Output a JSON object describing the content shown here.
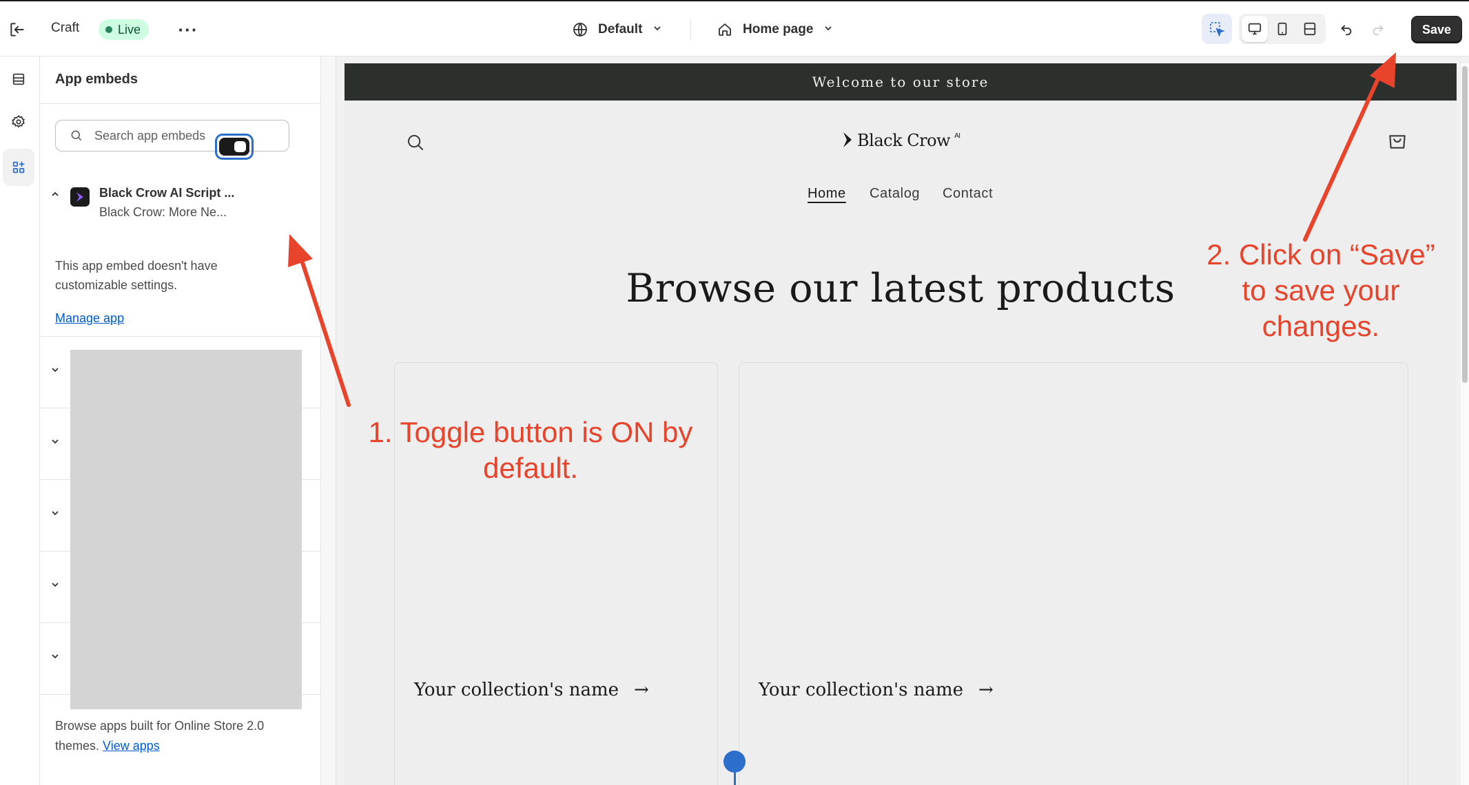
{
  "topbar": {
    "app_name": "Craft",
    "status_badge": "Live",
    "theme_label": "Default",
    "page_label": "Home page",
    "save_label": "Save"
  },
  "panel": {
    "title": "App embeds",
    "search_placeholder": "Search app embeds",
    "embed": {
      "title": "Black Crow AI Script ...",
      "subtitle": "Black Crow: More Ne...",
      "toggle_on": true,
      "description": "This app embed doesn't have customizable settings.",
      "manage_link": "Manage app"
    },
    "browse_note": "Browse apps built for Online Store 2.0 themes.",
    "browse_link": "View apps"
  },
  "preview": {
    "announcement": "Welcome to our store",
    "logo_text": "Black Crow",
    "logo_super": "AI",
    "nav": [
      "Home",
      "Catalog",
      "Contact"
    ],
    "heading": "Browse our latest products",
    "collections": [
      "Your collection's name",
      "Your collection's name"
    ],
    "arrow_glyph": "→"
  },
  "annotations": {
    "note_1_line_1": "1. Toggle button is ON by",
    "note_1_line_2": "default.",
    "note_2_line_1": "2. Click on “Save”",
    "note_2_line_2": "to save your",
    "note_2_line_3": "changes.",
    "color": "#e8432b"
  },
  "colors": {
    "accent": "#2c6ecb",
    "live_badge_bg": "#cdfee1",
    "announcement_bg": "#2b302d",
    "link": "#005bd3"
  }
}
